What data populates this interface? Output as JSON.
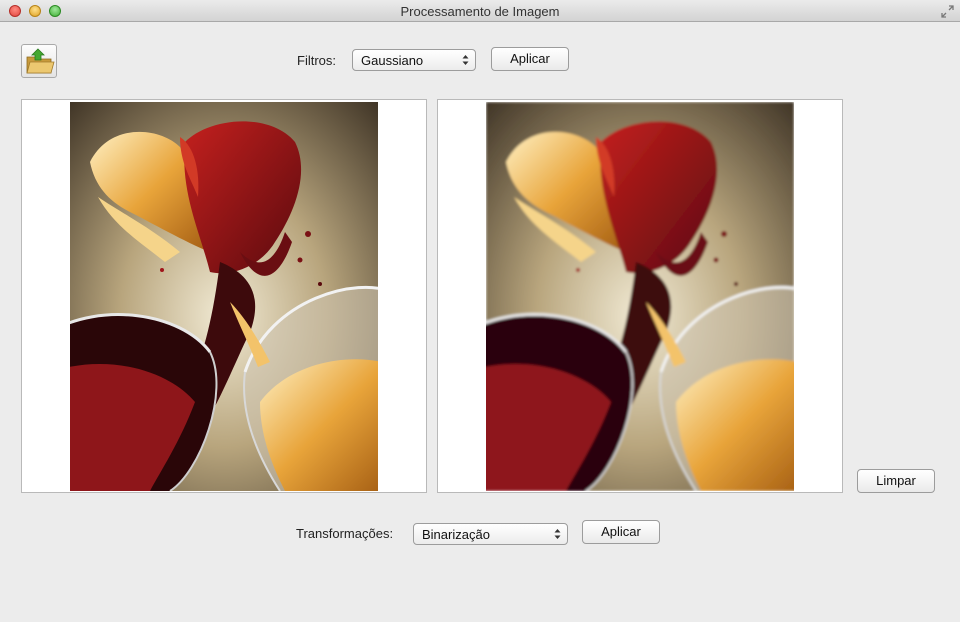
{
  "window": {
    "title": "Processamento de Imagem"
  },
  "toolbar": {
    "filters_label": "Filtros:",
    "filter_selected": "Gaussiano",
    "apply_filter_label": "Aplicar"
  },
  "side": {
    "clear_label": "Limpar"
  },
  "bottom": {
    "transform_label": "Transformações:",
    "transform_selected": "Binarização",
    "apply_transform_label": "Aplicar"
  },
  "colors": {
    "wine_dark": "#3d0a0c",
    "wine_red": "#a0141a",
    "gold": "#e0982c",
    "background_cream": "#e6dcc0"
  },
  "icons": {
    "open": "folder-open-icon",
    "select": "updown-arrows-icon"
  }
}
